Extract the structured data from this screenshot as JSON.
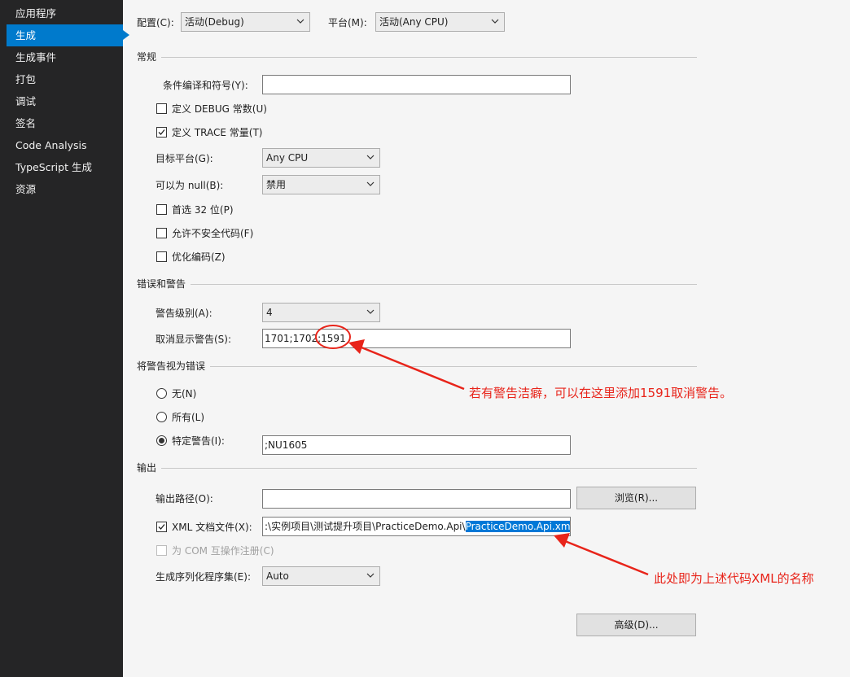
{
  "sidebar": {
    "items": [
      {
        "label": "应用程序"
      },
      {
        "label": "生成"
      },
      {
        "label": "生成事件"
      },
      {
        "label": "打包"
      },
      {
        "label": "调试"
      },
      {
        "label": "签名"
      },
      {
        "label": "Code Analysis"
      },
      {
        "label": "TypeScript 生成"
      },
      {
        "label": "资源"
      }
    ]
  },
  "header": {
    "config_label": "配置(C):",
    "config_value": "活动(Debug)",
    "platform_label": "平台(M):",
    "platform_value": "活动(Any CPU)"
  },
  "general": {
    "title": "常规",
    "conditional_symbols_label": "条件编译和符号(Y):",
    "conditional_symbols_value": "",
    "define_debug_label": "定义 DEBUG 常数(U)",
    "define_debug_checked": false,
    "define_trace_label": "定义 TRACE 常量(T)",
    "define_trace_checked": true,
    "target_platform_label": "目标平台(G):",
    "target_platform_value": "Any CPU",
    "nullable_label": "可以为 null(B):",
    "nullable_value": "禁用",
    "prefer32_label": "首选 32 位(P)",
    "prefer32_checked": false,
    "unsafe_label": "允许不安全代码(F)",
    "unsafe_checked": false,
    "optimize_label": "优化编码(Z)",
    "optimize_checked": false
  },
  "errors": {
    "title": "错误和警告",
    "warning_level_label": "警告级别(A):",
    "warning_level_value": "4",
    "suppress_label": "取消显示警告(S):",
    "suppress_value": "1701;1702;1591"
  },
  "treat_warnings": {
    "title": "将警告视为错误",
    "none_label": "无(N)",
    "all_label": "所有(L)",
    "specific_label": "特定警告(I):",
    "selected": "specific",
    "specific_value": ";NU1605"
  },
  "output": {
    "title": "输出",
    "path_label": "输出路径(O):",
    "path_value": "",
    "browse_label": "浏览(R)...",
    "xml_label": "XML 文档文件(X):",
    "xml_checked": true,
    "xml_value_prefix": ":\\实例项目\\测试提升项目\\PracticeDemo.Api\\",
    "xml_value_selected": "PracticeDemo.Api.xml",
    "com_label": "为 COM 互操作注册(C)",
    "com_checked": false,
    "serialization_label": "生成序列化程序集(E):",
    "serialization_value": "Auto"
  },
  "advanced_label": "高级(D)...",
  "annotations": {
    "warning_note": "若有警告洁癖，可以在这里添加1591取消警告。",
    "xml_note": "此处即为上述代码XML的名称",
    "color": "#e8241a"
  },
  "colors": {
    "sidebar_bg": "#252526",
    "accent": "#007acc",
    "page_bg": "#f5f5f5"
  }
}
